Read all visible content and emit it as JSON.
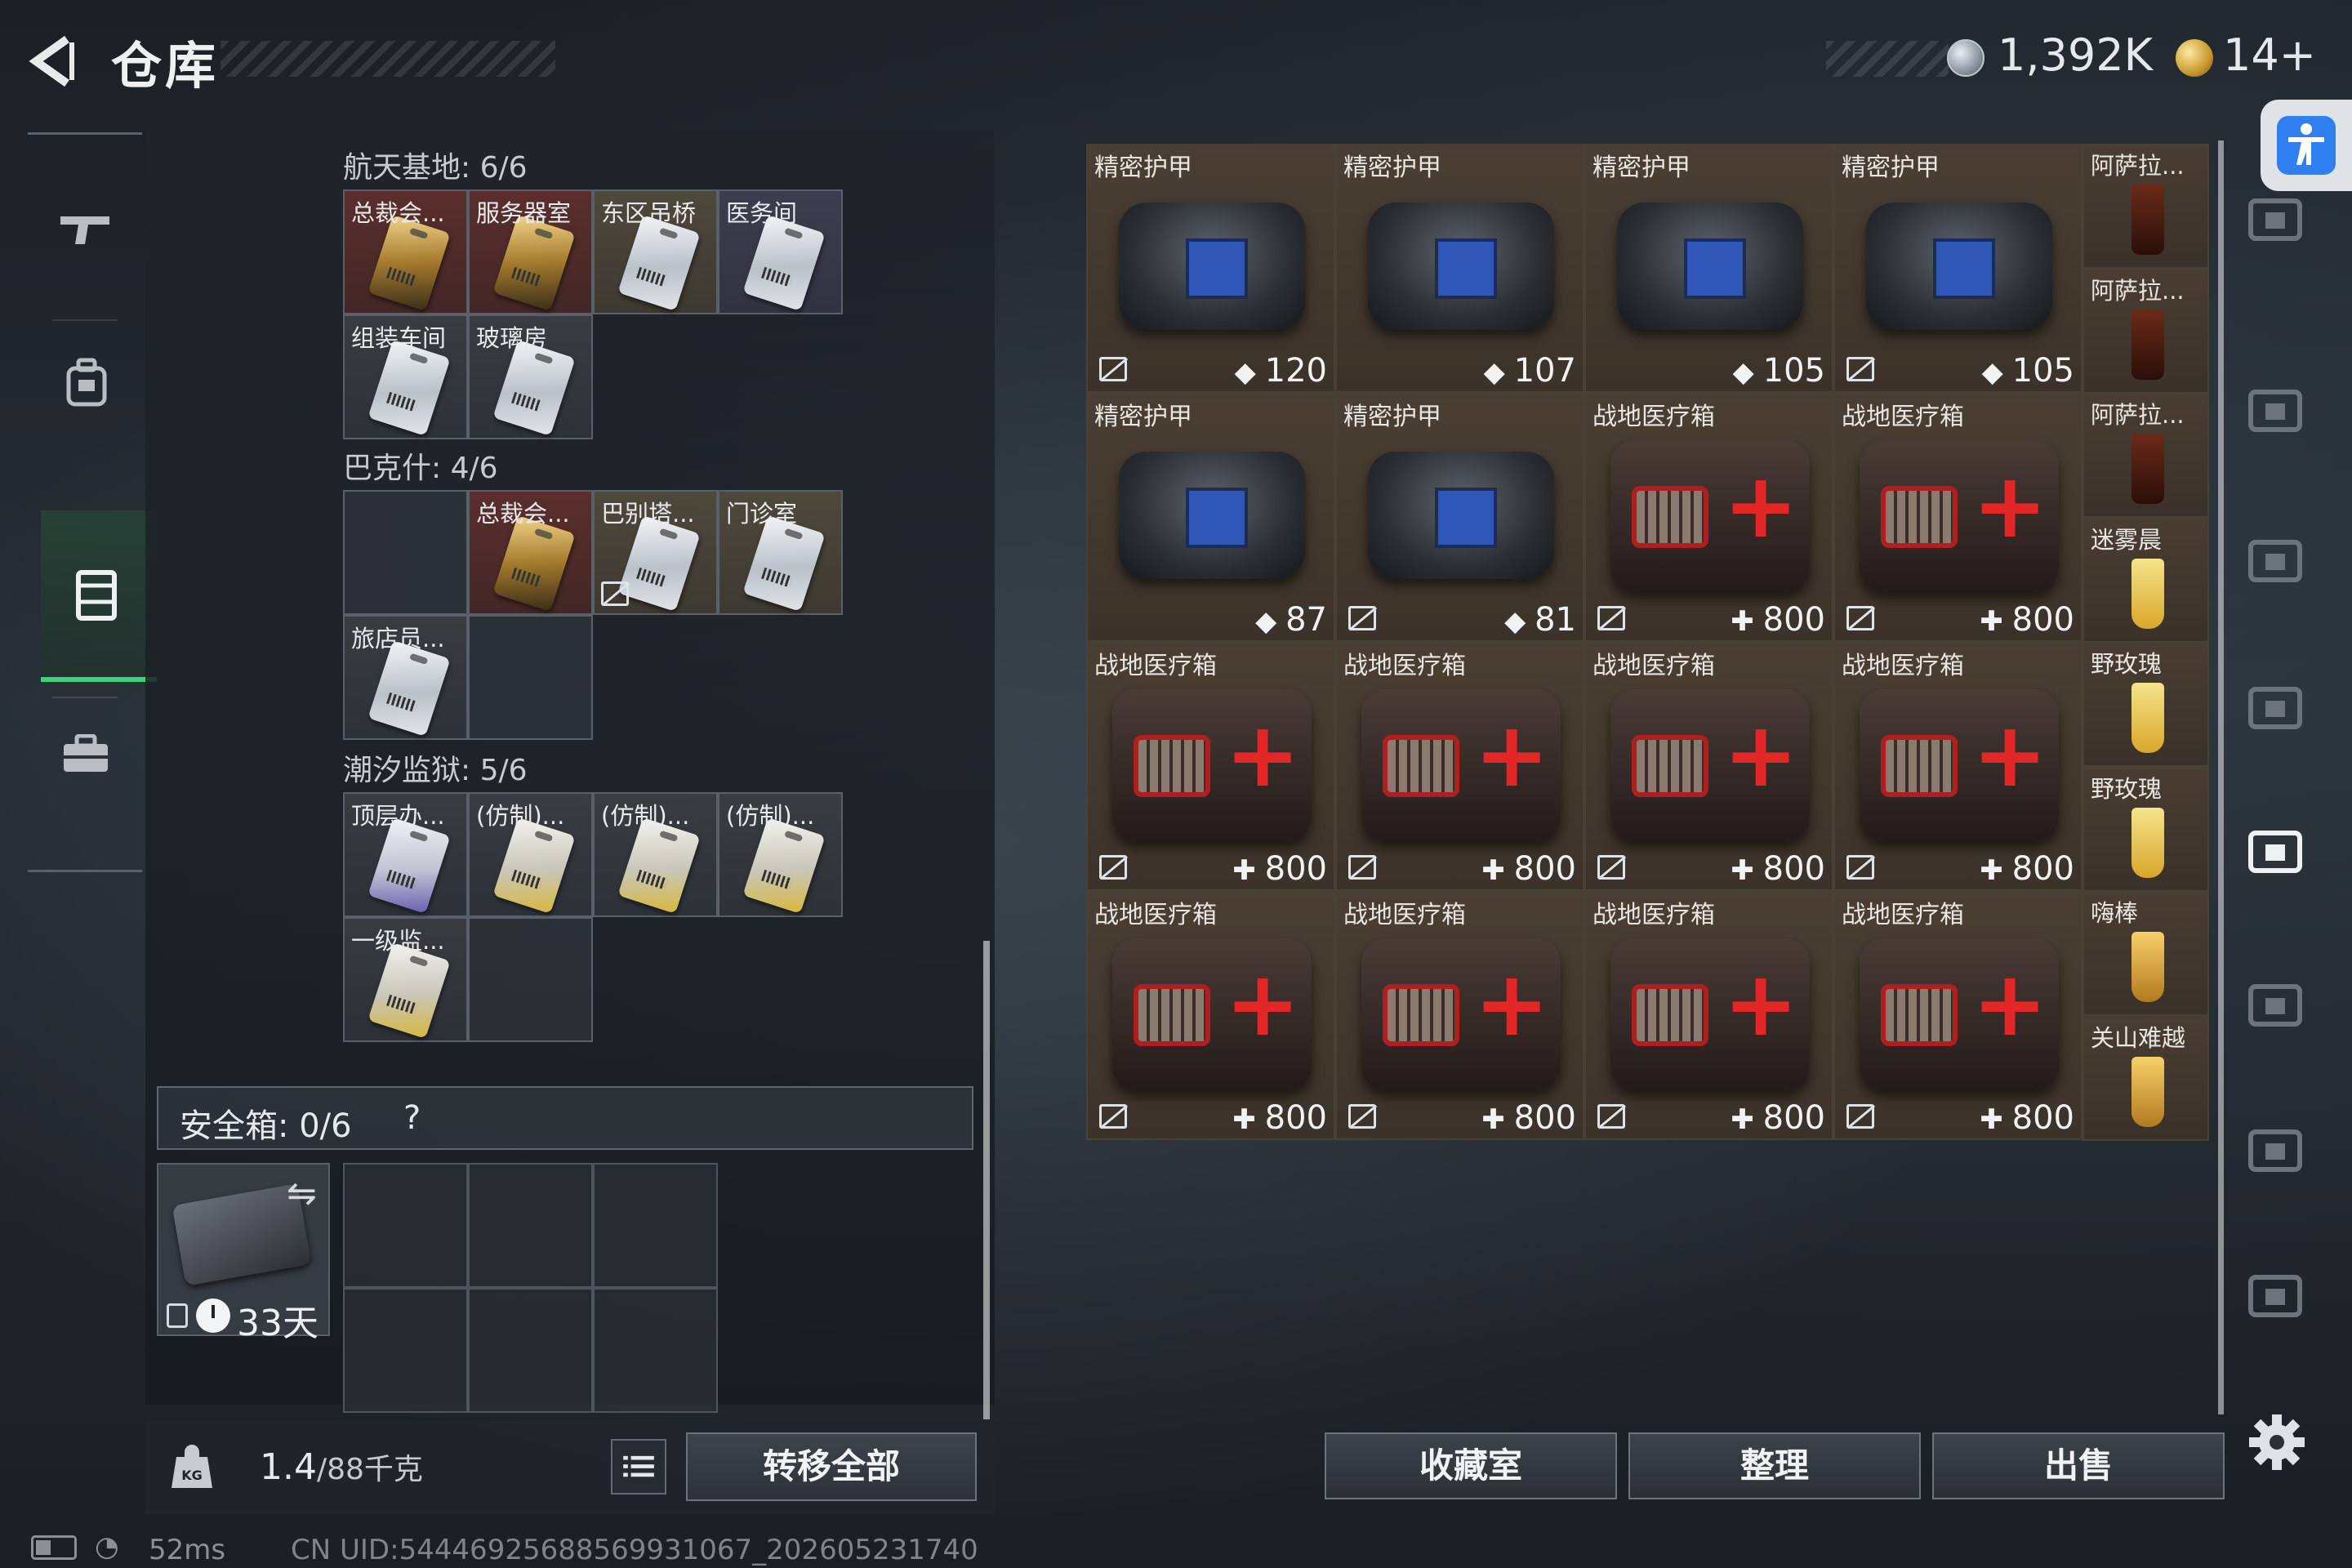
{
  "header": {
    "title": "仓库",
    "coins": "1,392K",
    "tickets": "14+"
  },
  "left_nav": {
    "items": [
      {
        "icon": "gun-icon"
      },
      {
        "icon": "backpack-icon"
      },
      {
        "icon": "locker-icon",
        "active": true
      },
      {
        "icon": "briefcase-icon"
      }
    ]
  },
  "stash": {
    "groups": [
      {
        "label": "航天基地: 6/6",
        "cells": [
          {
            "name": "总裁会...",
            "tone": "gold"
          },
          {
            "name": "服务器室",
            "tone": "gold"
          },
          {
            "name": "东区吊桥",
            "tone": "tan"
          },
          {
            "name": "医务间",
            "tone": "purple"
          },
          {
            "name": "组装车间",
            "tone": "filled"
          },
          {
            "name": "玻璃房",
            "tone": "filled"
          }
        ]
      },
      {
        "label": "巴克什: 4/6",
        "cells": [
          {
            "name": "",
            "tone": "empty"
          },
          {
            "name": "总裁会...",
            "tone": "gold"
          },
          {
            "name": "巴别塔...",
            "tone": "tan"
          },
          {
            "name": "门诊室",
            "tone": "tan"
          },
          {
            "name": "旅店员...",
            "tone": "filled"
          },
          {
            "name": "",
            "tone": "empty"
          }
        ]
      },
      {
        "label": "潮汐监狱: 5/6",
        "cells": [
          {
            "name": "顶层办...",
            "tone": "filled"
          },
          {
            "name": "(仿制)...",
            "tone": "filled"
          },
          {
            "name": "(仿制)...",
            "tone": "filled"
          },
          {
            "name": "(仿制)...",
            "tone": "filled"
          },
          {
            "name": "一级监...",
            "tone": "filled"
          },
          {
            "name": "",
            "tone": "empty"
          }
        ]
      }
    ],
    "safe_box": {
      "label": "安全箱: 0/6",
      "help": "?",
      "days": "33天"
    },
    "weight": "1.4",
    "weight_max": "/88千克",
    "transfer_all": "转移全部"
  },
  "inventory": {
    "rows": [
      [
        {
          "name": "精密护甲",
          "type": "armor",
          "value": "120",
          "value_icon": "shield-icon",
          "no_mark": true
        },
        {
          "name": "精密护甲",
          "type": "armor",
          "value": "107",
          "value_icon": "shield-icon",
          "no_mark": false
        },
        {
          "name": "精密护甲",
          "type": "armor",
          "value": "105",
          "value_icon": "shield-icon",
          "no_mark": false
        },
        {
          "name": "精密护甲",
          "type": "armor",
          "value": "105",
          "value_icon": "shield-icon",
          "no_mark": true
        }
      ],
      [
        {
          "name": "精密护甲",
          "type": "armor",
          "value": "87",
          "value_icon": "shield-icon",
          "no_mark": false
        },
        {
          "name": "精密护甲",
          "type": "armor",
          "value": "81",
          "value_icon": "shield-icon",
          "no_mark": true
        },
        {
          "name": "战地医疗箱",
          "type": "medkit",
          "value": "800",
          "value_icon": "plus-icon",
          "no_mark": true
        },
        {
          "name": "战地医疗箱",
          "type": "medkit",
          "value": "800",
          "value_icon": "plus-icon",
          "no_mark": true
        }
      ],
      [
        {
          "name": "战地医疗箱",
          "type": "medkit",
          "value": "800",
          "value_icon": "plus-icon",
          "no_mark": true
        },
        {
          "name": "战地医疗箱",
          "type": "medkit",
          "value": "800",
          "value_icon": "plus-icon",
          "no_mark": true
        },
        {
          "name": "战地医疗箱",
          "type": "medkit",
          "value": "800",
          "value_icon": "plus-icon",
          "no_mark": true
        },
        {
          "name": "战地医疗箱",
          "type": "medkit",
          "value": "800",
          "value_icon": "plus-icon",
          "no_mark": true
        }
      ],
      [
        {
          "name": "战地医疗箱",
          "type": "medkit",
          "value": "800",
          "value_icon": "plus-icon",
          "no_mark": true
        },
        {
          "name": "战地医疗箱",
          "type": "medkit",
          "value": "800",
          "value_icon": "plus-icon",
          "no_mark": true
        },
        {
          "name": "战地医疗箱",
          "type": "medkit",
          "value": "800",
          "value_icon": "plus-icon",
          "no_mark": true
        },
        {
          "name": "战地医疗箱",
          "type": "medkit",
          "value": "800",
          "value_icon": "plus-icon",
          "no_mark": true
        }
      ]
    ],
    "side_items": [
      {
        "name": "阿萨拉...",
        "drink": "dark"
      },
      {
        "name": "阿萨拉...",
        "drink": "dark"
      },
      {
        "name": "阿萨拉...",
        "drink": "dark"
      },
      {
        "name": "迷雾晨",
        "drink": "yellow"
      },
      {
        "name": "野玫瑰",
        "drink": "yellow"
      },
      {
        "name": "野玫瑰",
        "drink": "yellow"
      },
      {
        "name": "嗨棒",
        "drink": "gold"
      },
      {
        "name": "关山难越",
        "drink": "gold"
      }
    ]
  },
  "bottom_buttons": {
    "collection": "收藏室",
    "sort": "整理",
    "sell": "出售"
  },
  "status": {
    "ping": "52ms",
    "uid": "CN UID:5444692568856993​1067_202605231740"
  },
  "colors": {
    "accent_green": "#3bd27b",
    "accessibility_blue": "#2f7ff0"
  }
}
